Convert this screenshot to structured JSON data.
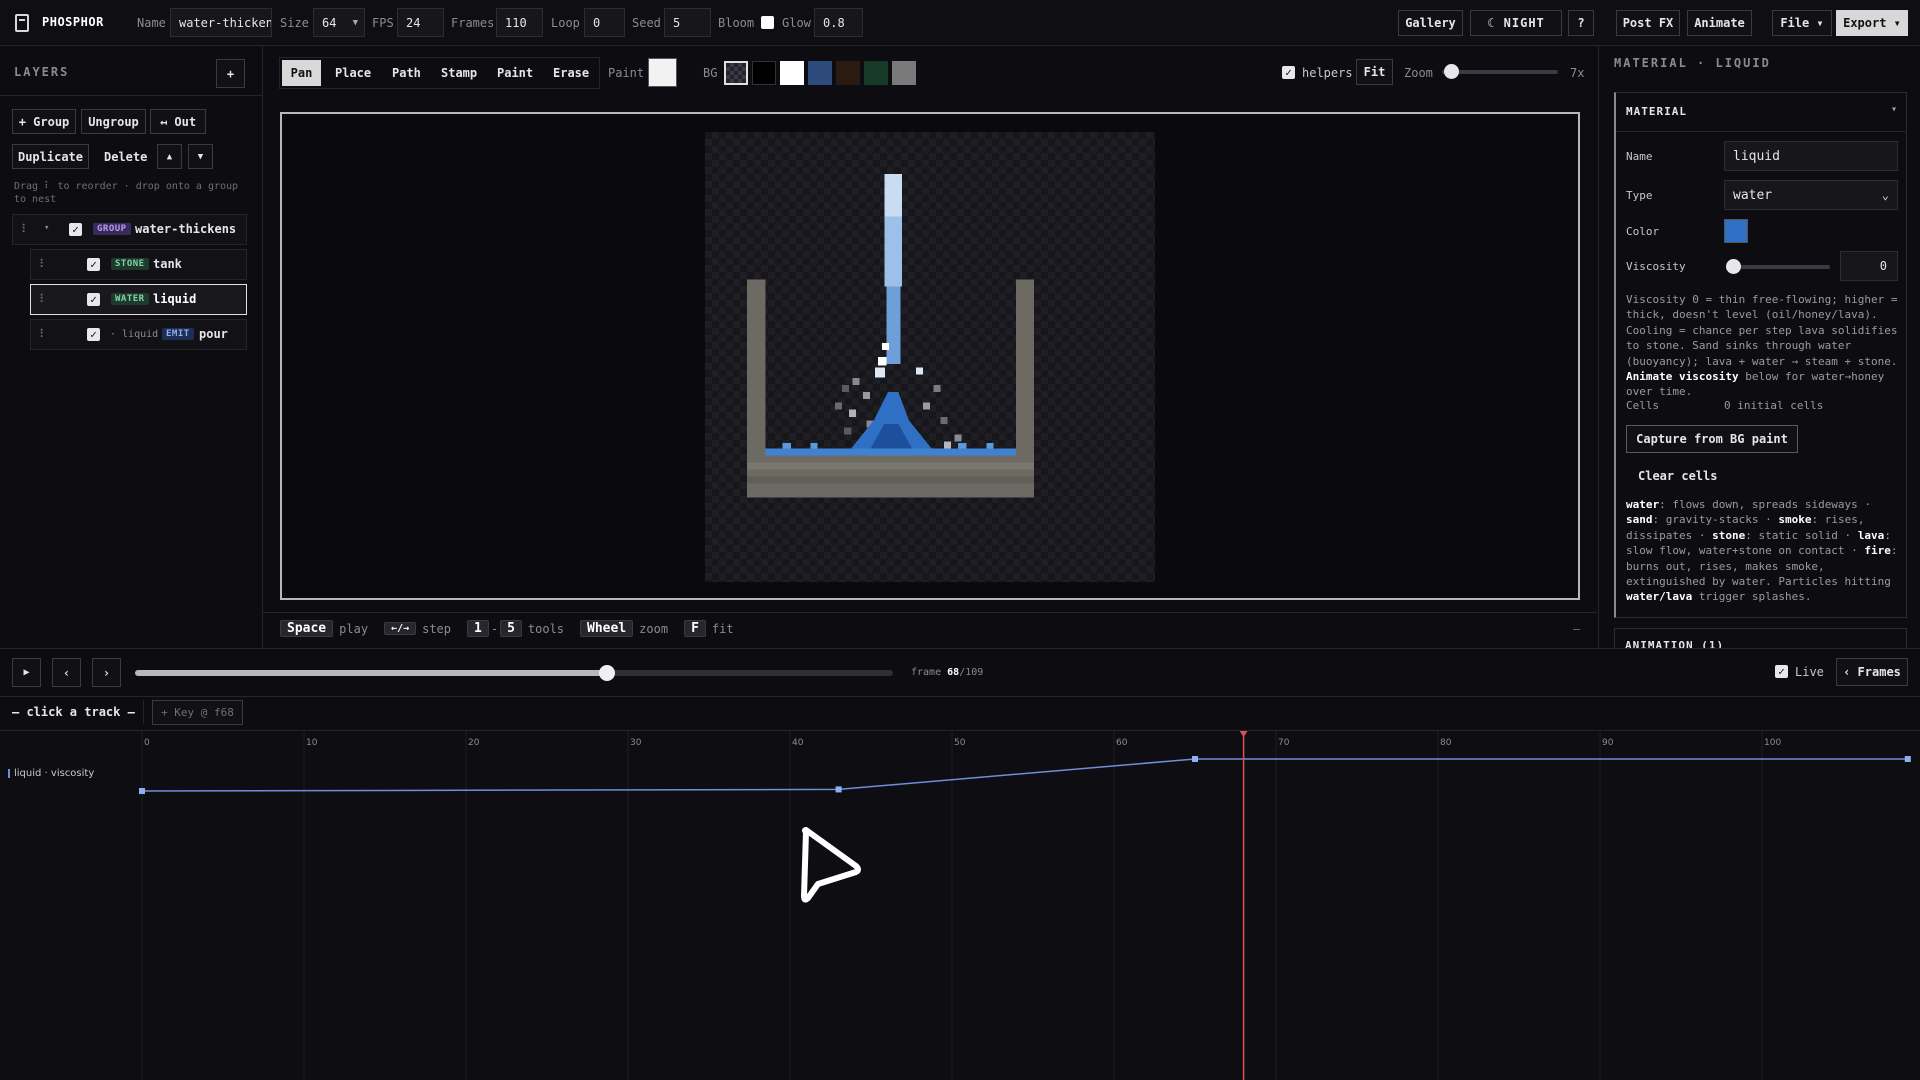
{
  "app": {
    "name": "PHOSPHOR"
  },
  "topbar": {
    "name_label": "Name",
    "name_value": "water-thicken",
    "size_label": "Size",
    "size_value": "64",
    "fps_label": "FPS",
    "fps_value": "24",
    "frames_label": "Frames",
    "frames_value": "110",
    "loop_label": "Loop",
    "loop_value": "0",
    "seed_label": "Seed",
    "seed_value": "5",
    "bloom_label": "Bloom",
    "bloom_checked": false,
    "glow_label": "Glow",
    "glow_value": "0.8",
    "gallery": "Gallery",
    "night": "☾ NIGHT",
    "help": "?",
    "postfx": "Post FX",
    "animate": "Animate",
    "file": "File ▾",
    "export": "Export ▾"
  },
  "layers": {
    "title": "LAYERS",
    "add": "+",
    "group_btn": "+ Group",
    "ungroup_btn": "Ungroup",
    "out_btn": "↤ Out",
    "duplicate_btn": "Duplicate",
    "delete_btn": "Delete",
    "up": "▲",
    "down": "▼",
    "hint": "Drag ⠇ to reorder · drop onto a group to nest",
    "items": [
      {
        "handle": "⠇",
        "arrow": "▾",
        "tag": "GROUP",
        "name": "water-thickens",
        "prefix": ""
      },
      {
        "handle": "⠇",
        "arrow": "",
        "tag": "STONE",
        "name": "tank",
        "prefix": ""
      },
      {
        "handle": "⠇",
        "arrow": "",
        "tag": "WATER",
        "name": "liquid",
        "prefix": ""
      },
      {
        "handle": "⠇",
        "arrow": "",
        "tag": "EMIT",
        "name": "pour",
        "prefix": "· liquid"
      }
    ]
  },
  "tools": {
    "items": [
      "Pan",
      "Place",
      "Path",
      "Stamp",
      "Paint",
      "Erase"
    ],
    "paint_label": "Paint",
    "bg_label": "BG",
    "bg_colors": [
      "#000000",
      "#ffffff",
      "#2e4a7d",
      "#2a1a12",
      "#153a26",
      "#7a7a7a"
    ],
    "paint_color": "#f2f2f2",
    "helpers_label": "helpers",
    "fit": "Fit",
    "zoom_label": "Zoom",
    "zoom_value": "7x"
  },
  "shortcuts": {
    "space": "Space",
    "play": "play",
    "arrows": "←/→",
    "step": "step",
    "k1": "1",
    "dash": "-",
    "k5": "5",
    "tools": "tools",
    "wheel": "Wheel",
    "zoom": "zoom",
    "f": "F",
    "fit": "fit",
    "collapse": "–"
  },
  "material": {
    "header": "MATERIAL · LIQUID",
    "section": "MATERIAL",
    "section_arrow": "▾",
    "name_label": "Name",
    "name_value": "liquid",
    "type_label": "Type",
    "type_value": "water",
    "color_label": "Color",
    "color_value": "#2f6fc4",
    "viscosity_label": "Viscosity",
    "viscosity_value": "0",
    "desc": "Viscosity 0 = thin free-flowing; higher = thick, doesn't level (oil/honey/lava). Cooling = chance per step lava solidifies to stone. Sand sinks through water (buoyancy); lava + water → steam + stone.",
    "desc_bold": "Animate viscosity",
    "desc_tail": "below for water→honey over time.",
    "cells_label": "Cells",
    "cells_value": "0 initial cells",
    "capture": "Capture from BG paint",
    "clear": "Clear cells",
    "legend": [
      {
        "k": "water",
        "v": ": flows down, spreads sideways · "
      },
      {
        "k": "sand",
        "v": ": gravity-stacks · "
      },
      {
        "k": "smoke",
        "v": ": rises, dissipates · "
      },
      {
        "k": "stone",
        "v": ": static solid · "
      },
      {
        "k": "lava",
        "v": ": slow flow, water+stone on contact · "
      },
      {
        "k": "fire",
        "v": ": burns out, rises, makes smoke, extinguished by water. Particles hitting "
      },
      {
        "k": "water/lava",
        "v": " trigger splashes."
      }
    ],
    "anim_section": "ANIMATION (1)"
  },
  "timeline": {
    "play": "▶",
    "prev": "‹",
    "next": "›",
    "frame_label": "frame",
    "frame_current": "68",
    "frame_total": "/109",
    "frame_fraction": 0.6239,
    "live_label": "Live",
    "frames_btn": "‹ Frames",
    "track_placeholder": "— click a track —",
    "key_btn": "+ Key @ f68",
    "ruler": [
      "0",
      "10",
      "20",
      "30",
      "40",
      "50",
      "60",
      "70",
      "80",
      "90",
      "100"
    ],
    "track_name": "liquid · viscosity",
    "keyframes": [
      {
        "frame": 0,
        "value": 0
      },
      {
        "frame": 43,
        "value": 0.05
      },
      {
        "frame": 65,
        "value": 1
      },
      {
        "frame": 109,
        "value": 1
      }
    ],
    "playhead_frame": 68
  }
}
